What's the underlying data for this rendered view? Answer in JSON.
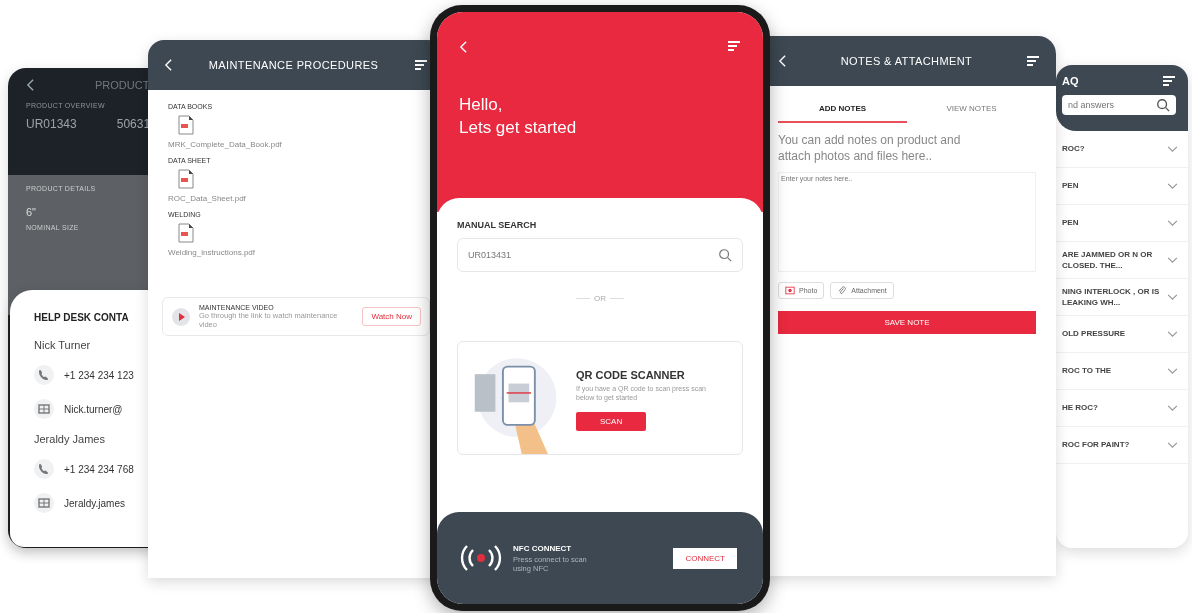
{
  "product_screen": {
    "title": "PRODUCT",
    "overview_label": "PRODUCT OVERVIEW",
    "codes": [
      "UR01343",
      "50631"
    ],
    "details_label": "PRODUCT DETAILS",
    "details": [
      {
        "value": "6\"",
        "label": "NOMINAL SIZE"
      }
    ]
  },
  "help_desk": {
    "title": "HELP DESK CONTA",
    "contacts": [
      {
        "name": "Nick Turner",
        "phone": "+1 234 234 123",
        "email": "Nick.turner@"
      },
      {
        "name": "Jeraldy James",
        "phone": "+1 234 234 768",
        "email": "Jeraldy.james"
      }
    ]
  },
  "maintenance_screen": {
    "title": "MAINTENANCE PROCEDURES",
    "sections": [
      {
        "heading": "DATA BOOKS",
        "file": "MRK_Complete_Data_Book.pdf"
      },
      {
        "heading": "DATA SHEET",
        "file": "ROC_Data_Sheet.pdf"
      },
      {
        "heading": "WELDING",
        "file": "Welding_instructions.pdf"
      }
    ],
    "video": {
      "title": "MAINTENANCE VIDEO",
      "subtitle": "Go through the link to watch maintenance video",
      "button": "Watch Now"
    }
  },
  "home_screen": {
    "greeting": "Hello,",
    "subtitle": "Lets get started",
    "search_label": "MANUAL SEARCH",
    "search_value": "UR013431",
    "divider": "OR",
    "qr": {
      "title": "QR CODE SCANNER",
      "text": "If you have a QR code to scan press scan below to get started",
      "button": "SCAN"
    },
    "nfc": {
      "title": "NFC CONNECT",
      "text": "Press connect to scan using NFC",
      "button": "CONNECT"
    }
  },
  "notes_screen": {
    "title": "NOTES & ATTACHMENT",
    "tabs": [
      {
        "label": "ADD NOTES",
        "selected": true
      },
      {
        "label": "VIEW NOTES",
        "selected": false
      }
    ],
    "intro": "You can add notes on product and attach photos and files here..",
    "placeholder": "Enter your notes here..",
    "attach_buttons": [
      "Photo",
      "Attachment"
    ],
    "save_button": "SAVE NOTE"
  },
  "faq_screen": {
    "title": "AQ",
    "search": {
      "placeholder": "nd answers"
    },
    "items": [
      {
        "question": "ROC?",
        "expanded": false
      },
      {
        "question": "PEN",
        "expanded": false
      },
      {
        "question": "PEN",
        "expanded": false
      },
      {
        "question": "ARE JAMMED OR N OR CLOSED. THE...",
        "expanded": false
      },
      {
        "question": "NING INTERLOCK , OR IS LEAKING WH...",
        "expanded": false
      },
      {
        "question": "OLD PRESSURE",
        "expanded": false
      },
      {
        "question": "ROC TO THE",
        "expanded": false
      },
      {
        "question": "HE ROC?",
        "expanded": false
      },
      {
        "question": "ROC FOR PAINT?",
        "expanded": false
      }
    ]
  }
}
